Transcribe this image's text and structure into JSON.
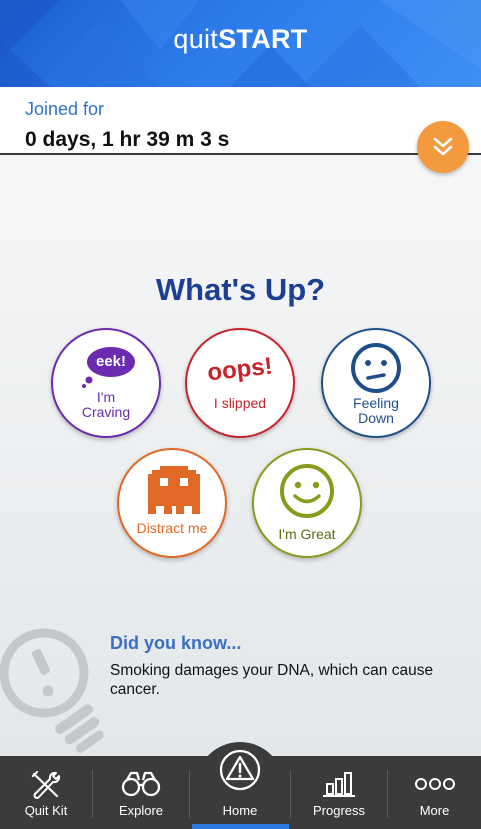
{
  "header": {
    "logo_light": "quit",
    "logo_bold": "START",
    "brand_color": "#2d7bea"
  },
  "joined": {
    "label": "Joined for",
    "value": "0 days, 1 hr 39 m 3 s",
    "expand_icon": "double-chevron-down-icon"
  },
  "main": {
    "title": "What's Up?",
    "moods": {
      "craving": {
        "bubble": "eek!",
        "label_line1": "I'm",
        "label_line2": "Craving",
        "color": "#6b2ab0"
      },
      "slipped": {
        "headline": "oops!",
        "label": "I slipped",
        "color": "#c8222a"
      },
      "down": {
        "label_line1": "Feeling",
        "label_line2": "Down",
        "color": "#1f4f8a"
      },
      "distract": {
        "label": "Distract me",
        "color": "#e06a25"
      },
      "great": {
        "label": "I'm Great",
        "color": "#8a9a1d"
      }
    },
    "did_you_know": {
      "title": "Did you know...",
      "text": "Smoking damages your DNA, which can cause cancer."
    }
  },
  "tabbar": {
    "tabs": [
      {
        "label": "Quit Kit",
        "icon": "tools-icon"
      },
      {
        "label": "Explore",
        "icon": "binoculars-icon"
      },
      {
        "label": "Home",
        "icon": "warning-triangle-icon",
        "active": true
      },
      {
        "label": "Progress",
        "icon": "bar-chart-icon"
      },
      {
        "label": "More",
        "icon": "more-dots-icon"
      }
    ]
  }
}
